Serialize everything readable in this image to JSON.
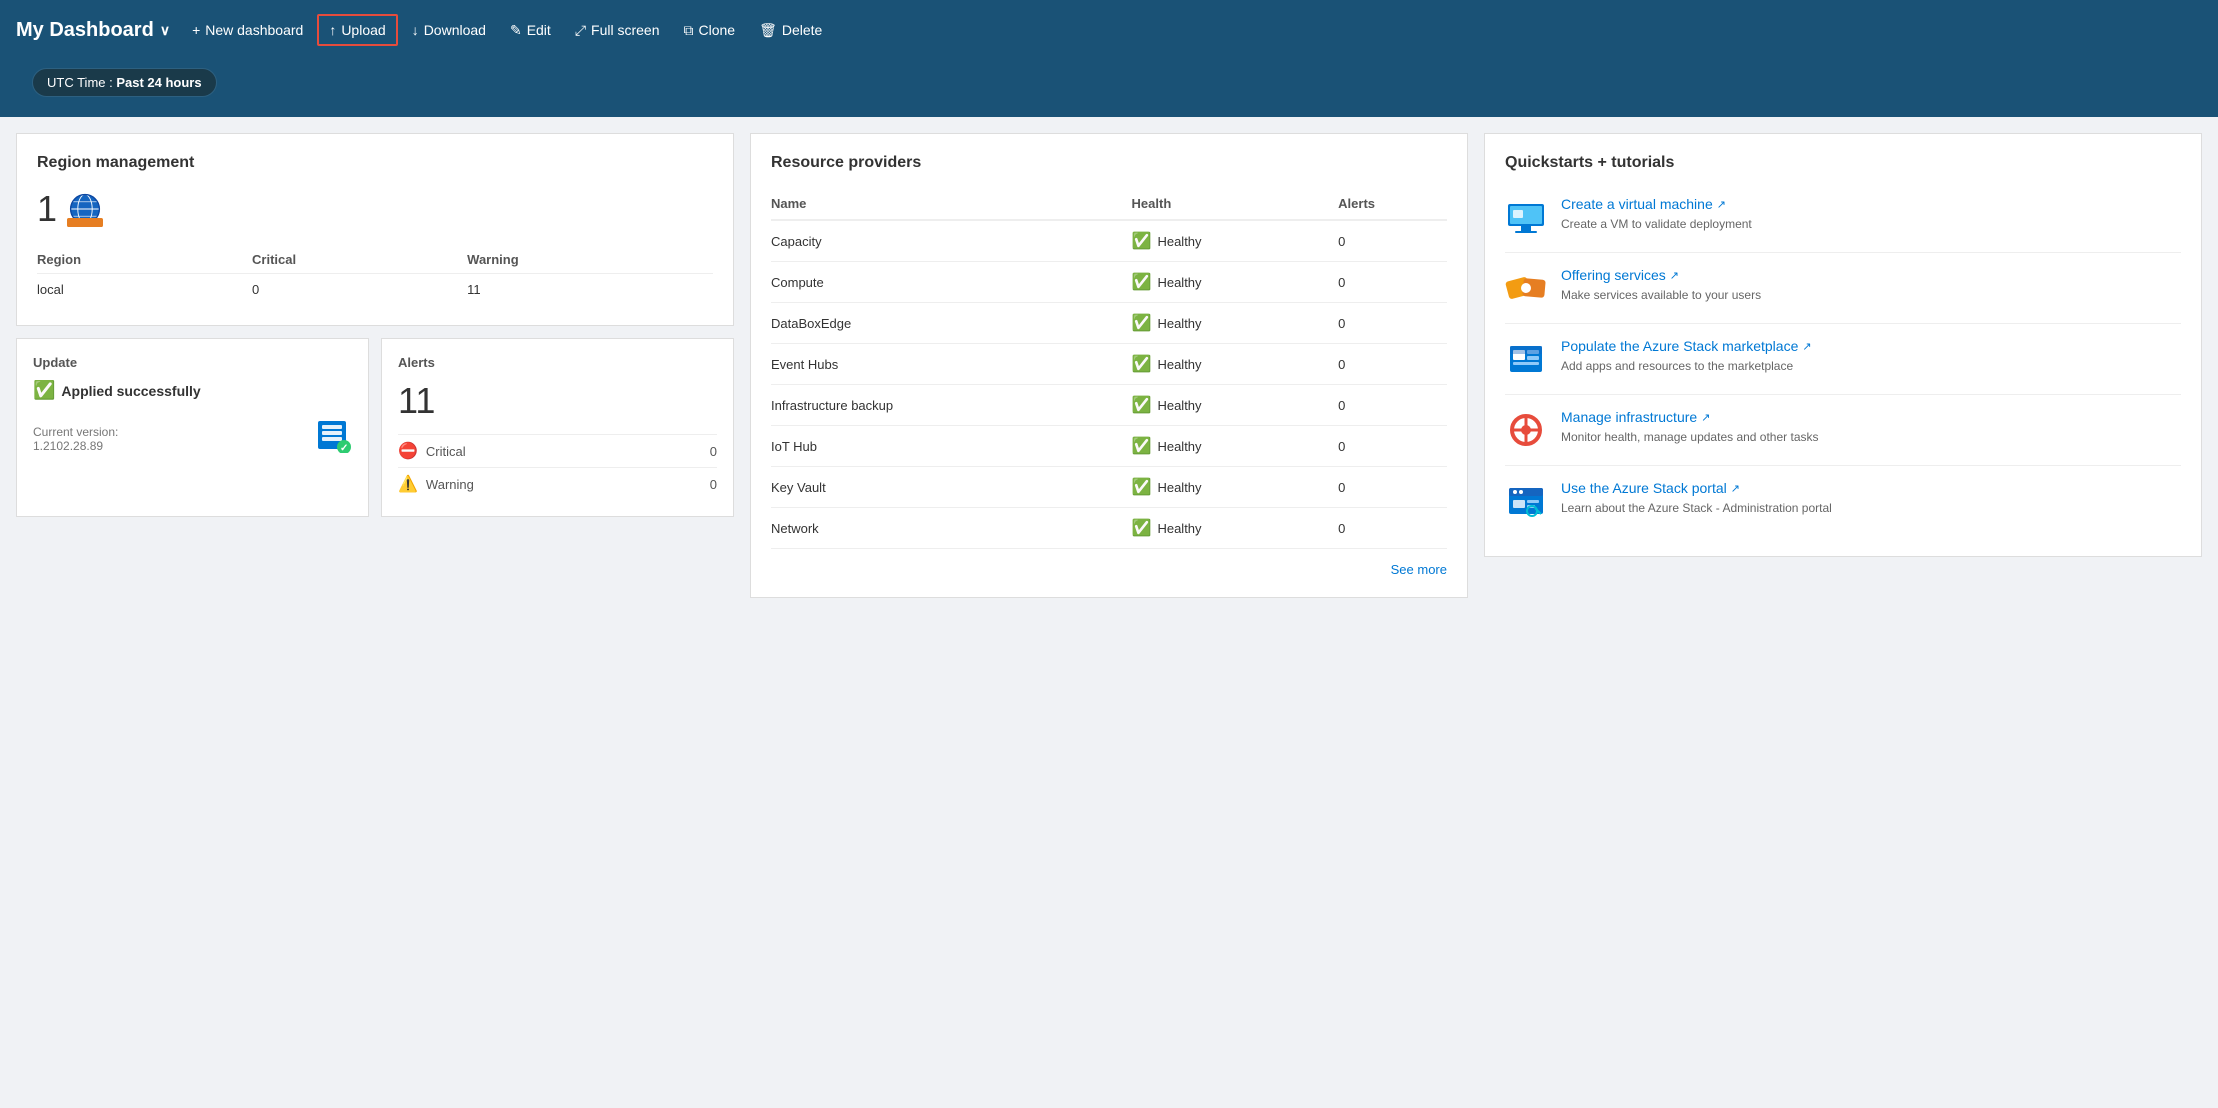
{
  "header": {
    "title": "My Dashboard",
    "chevron": "∨",
    "buttons": [
      {
        "id": "new-dashboard",
        "label": "New dashboard",
        "icon": "+"
      },
      {
        "id": "upload",
        "label": "Upload",
        "icon": "↑",
        "highlighted": true
      },
      {
        "id": "download",
        "label": "Download",
        "icon": "↓"
      },
      {
        "id": "edit",
        "label": "Edit",
        "icon": "✎"
      },
      {
        "id": "fullscreen",
        "label": "Full screen",
        "icon": "⤢"
      },
      {
        "id": "clone",
        "label": "Clone",
        "icon": "⧉"
      },
      {
        "id": "delete",
        "label": "Delete",
        "icon": "🗑"
      }
    ]
  },
  "time_badge": {
    "prefix": "UTC Time : ",
    "value": "Past 24 hours"
  },
  "region_management": {
    "title": "Region management",
    "count": "1",
    "columns": {
      "region": "Region",
      "critical": "Critical",
      "warning": "Warning"
    },
    "rows": [
      {
        "region": "local",
        "critical": "0",
        "warning": "11"
      }
    ]
  },
  "update": {
    "title": "Update",
    "status": "Applied successfully",
    "version_label": "Current version:",
    "version": "1.2102.28.89"
  },
  "alerts": {
    "title": "Alerts",
    "count": "11",
    "items": [
      {
        "type": "Critical",
        "count": "0",
        "icon_type": "error"
      },
      {
        "type": "Warning",
        "count": "0",
        "icon_type": "warning"
      }
    ]
  },
  "resource_providers": {
    "title": "Resource providers",
    "columns": {
      "name": "Name",
      "health": "Health",
      "alerts": "Alerts"
    },
    "rows": [
      {
        "name": "Capacity",
        "health": "Healthy",
        "alerts": "0"
      },
      {
        "name": "Compute",
        "health": "Healthy",
        "alerts": "0"
      },
      {
        "name": "DataBoxEdge",
        "health": "Healthy",
        "alerts": "0"
      },
      {
        "name": "Event Hubs",
        "health": "Healthy",
        "alerts": "0"
      },
      {
        "name": "Infrastructure backup",
        "health": "Healthy",
        "alerts": "0"
      },
      {
        "name": "IoT Hub",
        "health": "Healthy",
        "alerts": "0"
      },
      {
        "name": "Key Vault",
        "health": "Healthy",
        "alerts": "0"
      },
      {
        "name": "Network",
        "health": "Healthy",
        "alerts": "0"
      }
    ],
    "see_more": "See more"
  },
  "quickstarts": {
    "title": "Quickstarts + tutorials",
    "items": [
      {
        "id": "create-vm",
        "label": "Create a virtual machine",
        "description": "Create a VM to validate deployment",
        "icon": "vm"
      },
      {
        "id": "offering-services",
        "label": "Offering services",
        "description": "Make services available to your users",
        "icon": "services"
      },
      {
        "id": "marketplace",
        "label": "Populate the Azure Stack marketplace",
        "description": "Add apps and resources to the marketplace",
        "icon": "marketplace"
      },
      {
        "id": "manage-infra",
        "label": "Manage infrastructure",
        "description": "Monitor health, manage updates and other tasks",
        "icon": "infra"
      },
      {
        "id": "portal",
        "label": "Use the Azure Stack portal",
        "description": "Learn about the Azure Stack - Administration portal",
        "icon": "portal"
      }
    ]
  }
}
